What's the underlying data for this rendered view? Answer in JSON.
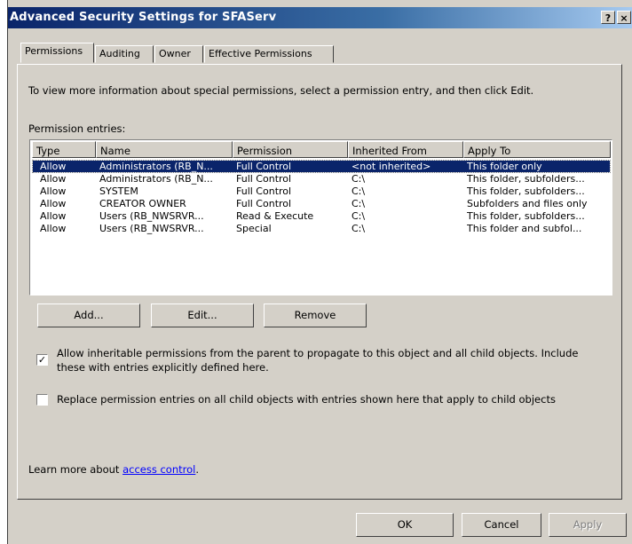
{
  "window": {
    "title": "Advanced Security Settings for SFAServ",
    "help_glyph": "?",
    "close_glyph": "×"
  },
  "tabs": [
    {
      "label": "Permissions",
      "active": true
    },
    {
      "label": "Auditing",
      "active": false
    },
    {
      "label": "Owner",
      "active": false
    },
    {
      "label": "Effective Permissions",
      "active": false
    }
  ],
  "intro_text": "To view more information about special permissions, select a permission entry, and then click Edit.",
  "entries_label": "Permission entries:",
  "columns": [
    "Type",
    "Name",
    "Permission",
    "Inherited From",
    "Apply To"
  ],
  "rows": [
    {
      "type": "Allow",
      "name": "Administrators (RB_N...",
      "permission": "Full Control",
      "inherited_from": "<not inherited>",
      "apply_to": "This folder only",
      "selected": true
    },
    {
      "type": "Allow",
      "name": "Administrators (RB_N...",
      "permission": "Full Control",
      "inherited_from": "C:\\",
      "apply_to": "This folder, subfolders...",
      "selected": false
    },
    {
      "type": "Allow",
      "name": "SYSTEM",
      "permission": "Full Control",
      "inherited_from": "C:\\",
      "apply_to": "This folder, subfolders...",
      "selected": false
    },
    {
      "type": "Allow",
      "name": "CREATOR OWNER",
      "permission": "Full Control",
      "inherited_from": "C:\\",
      "apply_to": "Subfolders and files only",
      "selected": false
    },
    {
      "type": "Allow",
      "name": "Users (RB_NWSRVR...",
      "permission": "Read & Execute",
      "inherited_from": "C:\\",
      "apply_to": "This folder, subfolders...",
      "selected": false
    },
    {
      "type": "Allow",
      "name": "Users (RB_NWSRVR...",
      "permission": "Special",
      "inherited_from": "C:\\",
      "apply_to": "This folder and subfol...",
      "selected": false
    }
  ],
  "buttons": {
    "add": "Add...",
    "edit": "Edit...",
    "remove": "Remove"
  },
  "inherit_checkbox": {
    "checked": true,
    "label_line1": "Allow inheritable permissions from the parent to propagate to this object and all child objects. Include",
    "label_line2": "these with entries explicitly defined here."
  },
  "replace_checkbox": {
    "checked": false,
    "label": "Replace permission entries on all child objects with entries shown here that apply to child objects"
  },
  "learn_more": {
    "prefix": "Learn more about ",
    "link_text": "access control",
    "suffix": "."
  },
  "dialog_buttons": {
    "ok": "OK",
    "cancel": "Cancel",
    "apply": "Apply"
  },
  "colors": {
    "selection": "#0a246a",
    "titlebar": "#0a246a",
    "face": "#d4d0c8",
    "link": "#0000ff"
  }
}
